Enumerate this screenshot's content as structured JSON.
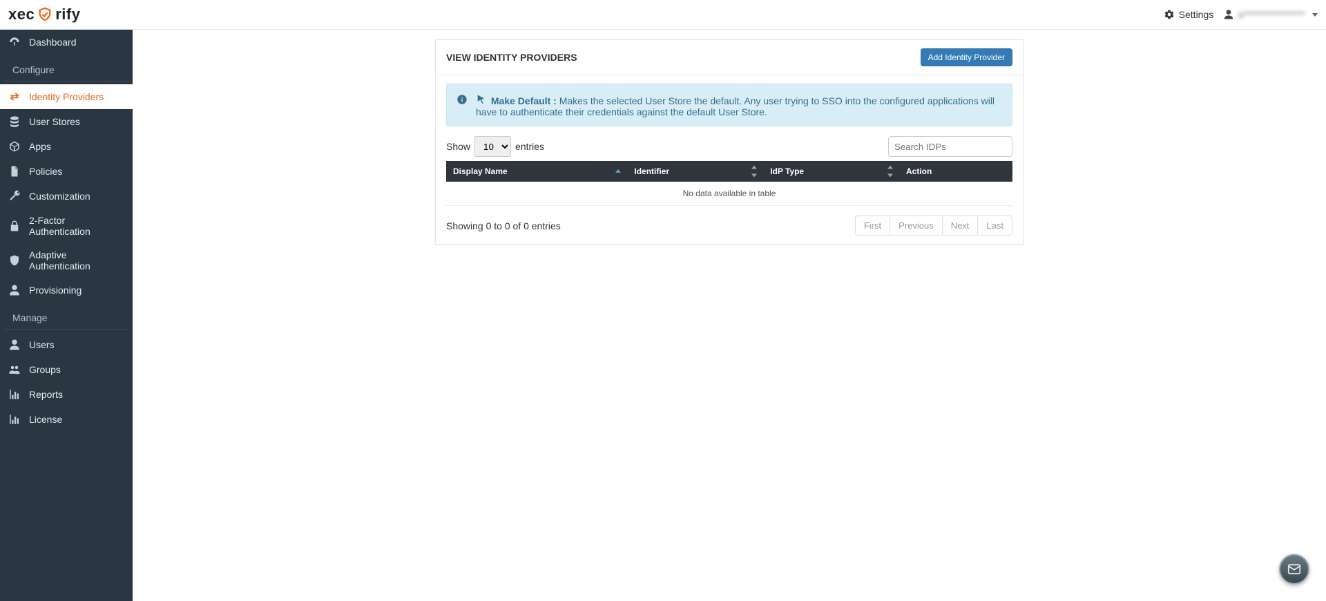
{
  "brand": {
    "left": "xec",
    "right": "rify"
  },
  "topbar": {
    "settings_label": "Settings",
    "user_email": "s***************"
  },
  "sidebar": {
    "items": [
      {
        "label": "Dashboard"
      },
      {
        "section": "Configure"
      },
      {
        "label": "Identity Providers",
        "active": true
      },
      {
        "label": "User Stores"
      },
      {
        "label": "Apps"
      },
      {
        "label": "Policies"
      },
      {
        "label": "Customization"
      },
      {
        "label": "2-Factor Authentication"
      },
      {
        "label": "Adaptive Authentication"
      },
      {
        "label": "Provisioning"
      },
      {
        "section": "Manage"
      },
      {
        "label": "Users"
      },
      {
        "label": "Groups"
      },
      {
        "label": "Reports"
      },
      {
        "label": "License"
      }
    ]
  },
  "panel": {
    "title": "VIEW IDENTITY PROVIDERS",
    "add_button": "Add Identity Provider",
    "alert_strong": "Make Default :",
    "alert_text": "Makes the selected User Store the default. Any user trying to SSO into the configured applications will have to authenticate their credentials against the default User Store."
  },
  "datatable": {
    "length_prefix": "Show",
    "length_value": "10",
    "length_suffix": "entries",
    "search_placeholder": "Search IDPs",
    "columns": [
      "Display Name",
      "Identifier",
      "IdP Type",
      "Action"
    ],
    "empty": "No data available in table",
    "info": "Showing 0 to 0 of 0 entries",
    "paginate": {
      "first": "First",
      "previous": "Previous",
      "next": "Next",
      "last": "Last"
    }
  }
}
